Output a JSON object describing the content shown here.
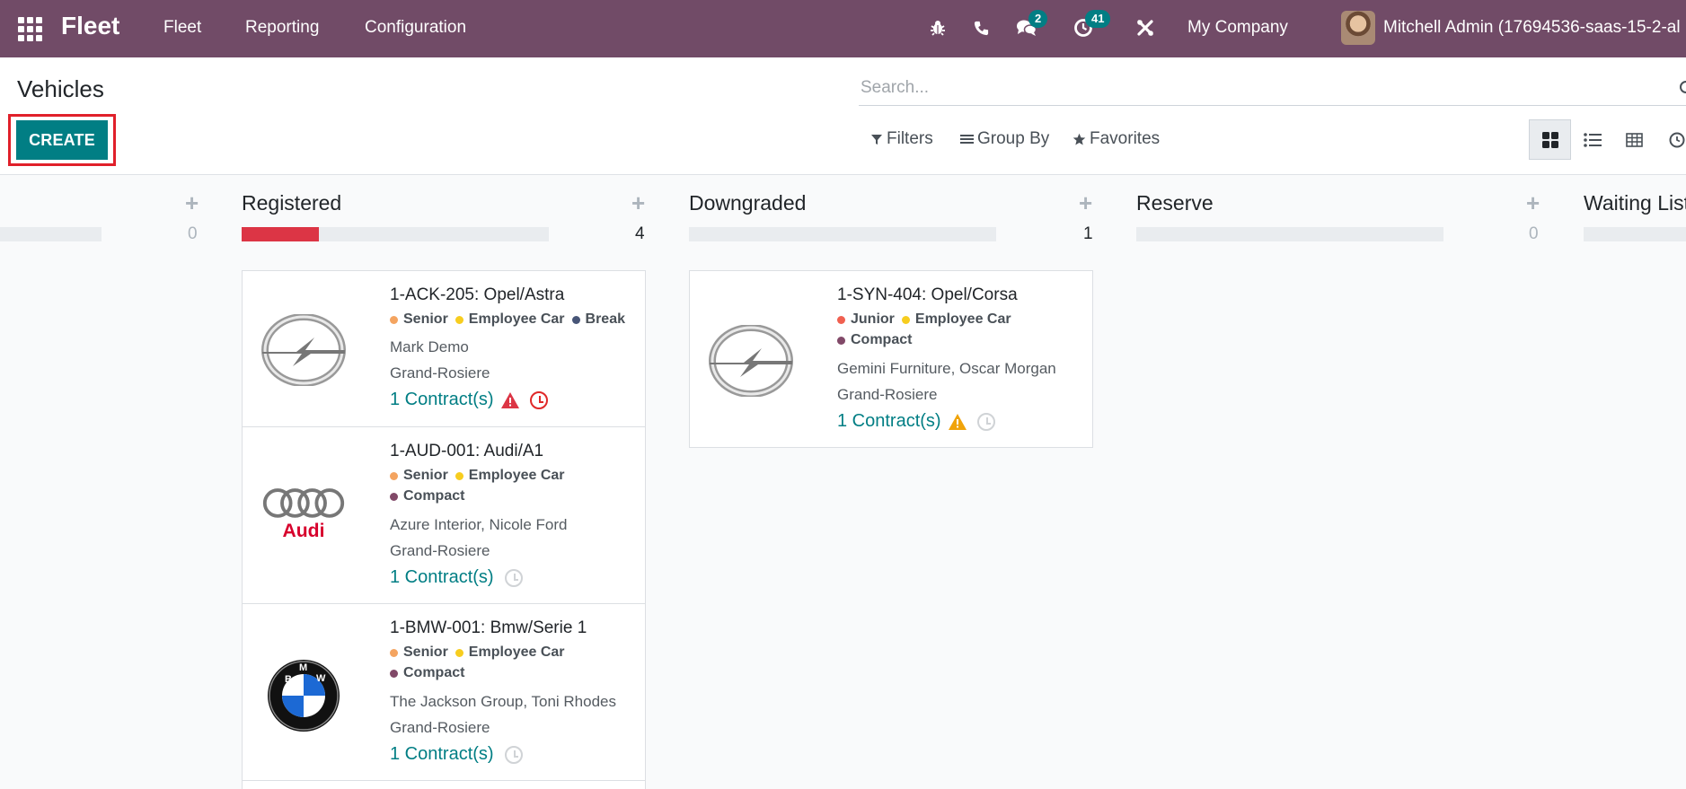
{
  "navbar": {
    "brand": "Fleet",
    "menu": [
      "Fleet",
      "Reporting",
      "Configuration"
    ],
    "messages_badge": "2",
    "activities_badge": "41",
    "company": "My Company",
    "user": "Mitchell Admin (17694536-saas-15-2-al"
  },
  "control_panel": {
    "title": "Vehicles",
    "create_label": "CREATE",
    "search_placeholder": "Search...",
    "filters_label": "Filters",
    "groupby_label": "Group By",
    "favorites_label": "Favorites"
  },
  "columns": [
    {
      "title": "",
      "count": "0",
      "progress": 0
    },
    {
      "title": "Registered",
      "count": "4",
      "progress": 0.25
    },
    {
      "title": "Downgraded",
      "count": "1",
      "progress": 0
    },
    {
      "title": "Reserve",
      "count": "0",
      "progress": 0
    },
    {
      "title": "Waiting List",
      "count": "",
      "progress": 0
    }
  ],
  "cards": [
    {
      "logo": "opel-logo",
      "title": "1-ACK-205: Opel/Astra",
      "tags_line1": [
        {
          "label": "Senior",
          "color": "#f4a460"
        },
        {
          "label": "Employee Car",
          "color": "#f7cd1f"
        },
        {
          "label": "Break",
          "color": "#475577"
        }
      ],
      "tags_line2": [],
      "driver": "Mark Demo",
      "location": "Grand-Rosiere",
      "contracts": "1 Contract(s)",
      "warning_color": "#dc3545",
      "clock": "red"
    },
    {
      "logo": "audi-logo",
      "title": "1-AUD-001: Audi/A1",
      "tags_line1": [
        {
          "label": "Senior",
          "color": "#f4a460"
        },
        {
          "label": "Employee Car",
          "color": "#f7cd1f"
        }
      ],
      "tags_line2": [
        {
          "label": "Compact",
          "color": "#814968"
        }
      ],
      "driver": "Azure Interior, Nicole Ford",
      "location": "Grand-Rosiere",
      "contracts": "1 Contract(s)",
      "warning_color": "",
      "clock": "grey"
    },
    {
      "logo": "bmw-logo",
      "title": "1-BMW-001: Bmw/Serie 1",
      "tags_line1": [
        {
          "label": "Senior",
          "color": "#f4a460"
        },
        {
          "label": "Employee Car",
          "color": "#f7cd1f"
        }
      ],
      "tags_line2": [
        {
          "label": "Compact",
          "color": "#814968"
        }
      ],
      "driver": "The Jackson Group, Toni Rhodes",
      "location": "Grand-Rosiere",
      "contracts": "1 Contract(s)",
      "warning_color": "",
      "clock": "grey"
    },
    {
      "logo": "opel-logo",
      "title": "1-SYN-404: Opel/Corsa",
      "tags_line1": [
        {
          "label": "Junior",
          "color": "#f06050"
        },
        {
          "label": "Employee Car",
          "color": "#f7cd1f"
        }
      ],
      "tags_line2": [
        {
          "label": "Compact",
          "color": "#814968"
        }
      ],
      "driver": "Gemini Furniture, Oscar Morgan",
      "location": "Grand-Rosiere",
      "contracts": "1 Contract(s)",
      "warning_color": "#f0a30a",
      "clock": "grey"
    }
  ]
}
